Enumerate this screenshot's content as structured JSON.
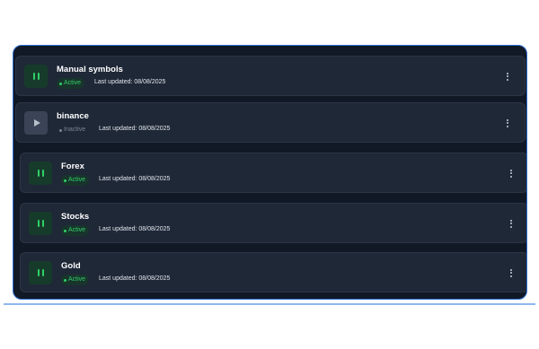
{
  "items": [
    {
      "title": "Manual symbols",
      "status": "Active",
      "updated": "Last updated: 08/08/2025",
      "toggle_icon": "pause-icon",
      "menu_icon": "more-vertical-icon"
    },
    {
      "title": "binance",
      "status": "Inactive",
      "updated": "Last updated: 08/08/2025",
      "toggle_icon": "play-icon",
      "menu_icon": "more-vertical-icon"
    },
    {
      "title": "Forex",
      "status": "Active",
      "updated": "Last updated: 08/08/2025",
      "toggle_icon": "pause-icon",
      "menu_icon": "more-vertical-icon"
    },
    {
      "title": "Stocks",
      "status": "Active",
      "updated": "Last updated: 08/08/2025",
      "toggle_icon": "pause-icon",
      "menu_icon": "more-vertical-icon"
    },
    {
      "title": "Gold",
      "status": "Active",
      "updated": "Last updated: 08/08/2025",
      "toggle_icon": "pause-icon",
      "menu_icon": "more-vertical-icon"
    }
  ],
  "colors": {
    "background": "#111826",
    "card": "#1f2837",
    "active_green": "#31cf69",
    "inactive_gray": "#7c8594",
    "border_accent": "#2f6fd0"
  }
}
